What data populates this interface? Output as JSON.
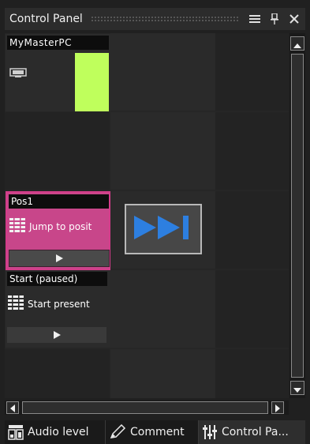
{
  "panel": {
    "title": "Control Panel"
  },
  "title_buttons": {
    "menu_icon": "menu-icon",
    "pin_icon": "pin-icon",
    "close_icon": "close-icon"
  },
  "cells": {
    "master": {
      "name": "MyMasterPC",
      "icon": "display-icon",
      "color": "#bfff5c"
    },
    "pos1": {
      "name": "Pos1",
      "action": "Jump to posit",
      "color": "#c8468a"
    },
    "start": {
      "name": "Start  (paused)",
      "action": "Start present"
    }
  },
  "go_next": {
    "icon": "go-next-icon",
    "color": "#2d7fe0"
  },
  "tabs": [
    {
      "label": "Audio level",
      "icon": "audio-level-icon"
    },
    {
      "label": "Comment",
      "icon": "pencil-icon"
    },
    {
      "label": "Control Pa...",
      "icon": "control-panel-icon"
    }
  ]
}
